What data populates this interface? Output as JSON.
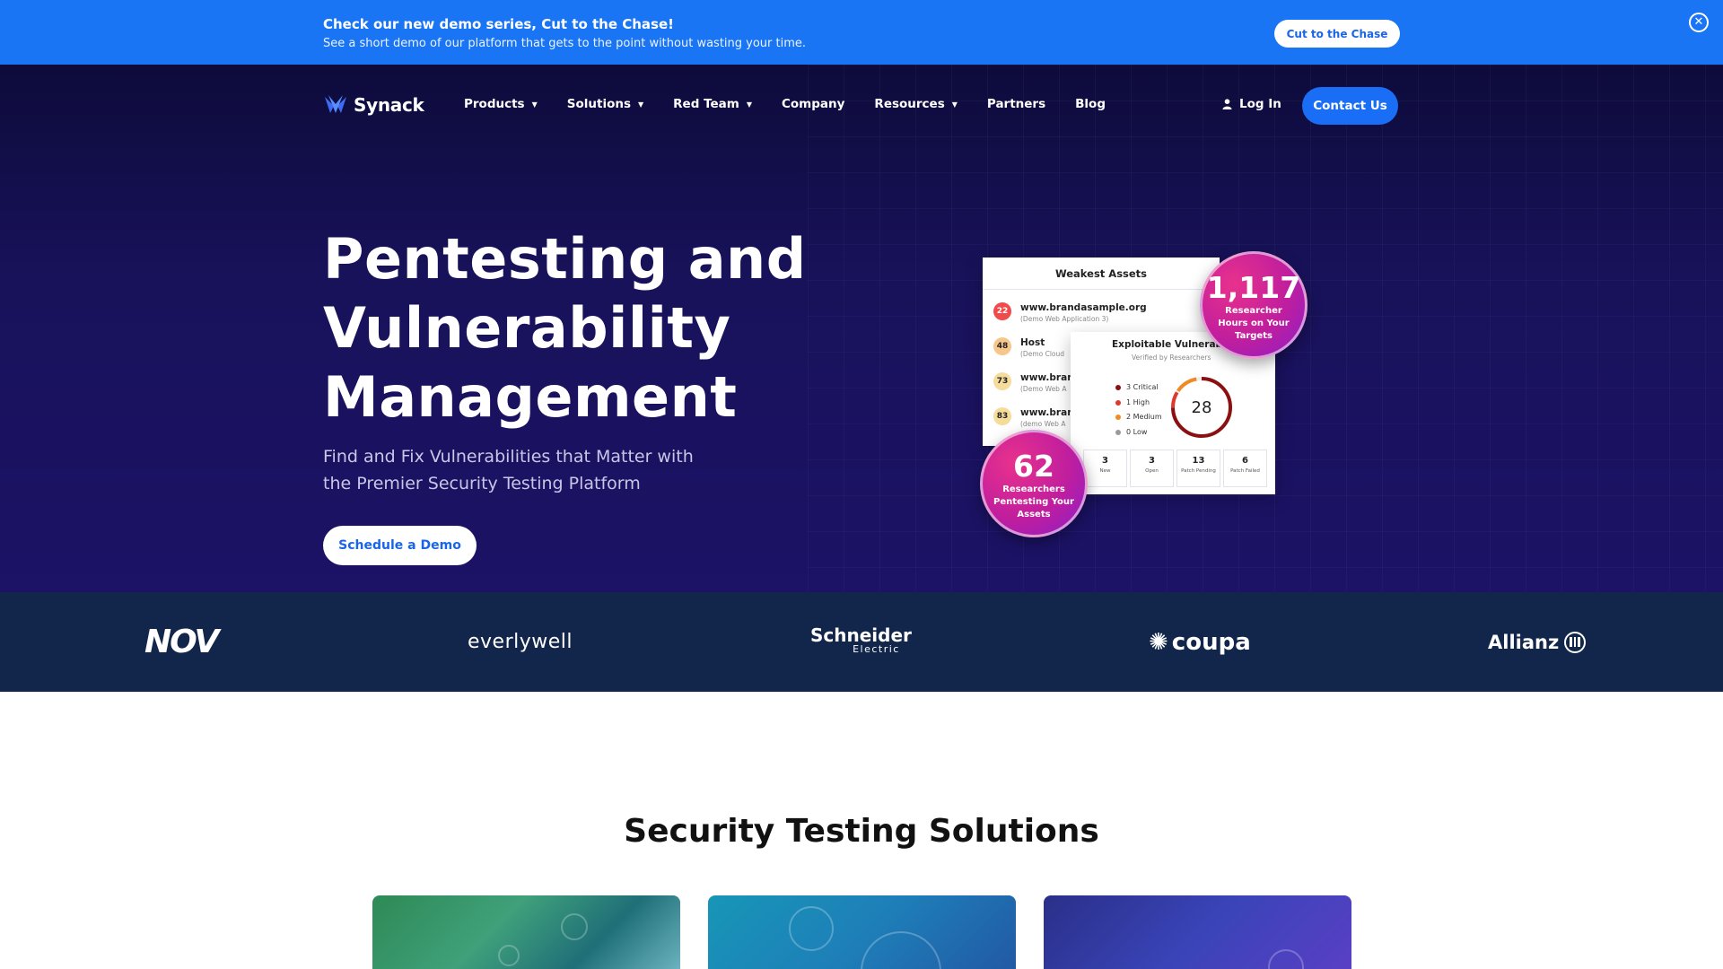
{
  "announcement": {
    "title": "Check our new demo series, Cut to the Chase!",
    "subtitle": "See a short demo of our platform that gets to the point without wasting your time.",
    "cta_label": "Cut to the Chase",
    "close_icon": "close-circle-icon"
  },
  "nav": {
    "logo_text": "Synack",
    "items": [
      {
        "label": "Products",
        "has_caret": true
      },
      {
        "label": "Solutions",
        "has_caret": true
      },
      {
        "label": "Red Team",
        "has_caret": true
      },
      {
        "label": "Company",
        "has_caret": false
      },
      {
        "label": "Resources",
        "has_caret": true
      },
      {
        "label": "Partners",
        "has_caret": false
      },
      {
        "label": "Blog",
        "has_caret": false
      }
    ],
    "login_label": "Log In",
    "contact_label": "Contact Us"
  },
  "hero": {
    "heading_lines": [
      "Pentesting and",
      "Vulnerability",
      "Management"
    ],
    "lead_lines": [
      "Find and Fix Vulnerabilities that Matter with",
      "the Premier Security Testing Platform"
    ],
    "cta_label": "Schedule a Demo"
  },
  "dashboard": {
    "weakest_title": "Weakest Assets",
    "assets": [
      {
        "score": "22",
        "name": "www.brandasample.org",
        "sub": "(Demo Web Application 3)",
        "color": "#f04a4a"
      },
      {
        "score": "48",
        "name": "Host",
        "sub": "(Demo Cloud",
        "color": "#f7c68a"
      },
      {
        "score": "73",
        "name": "www.bran",
        "sub": "(Demo Web A",
        "color": "#f5dc9a"
      },
      {
        "score": "83",
        "name": "www.bran",
        "sub": "(demo Web A",
        "color": "#f5dc9a"
      }
    ],
    "exploitable_title": "Exploitable Vulnerabilitie",
    "exploitable_sub": "Verified by Researchers",
    "legend": [
      {
        "label": "3 Critical",
        "color": "#8b1010"
      },
      {
        "label": "1 High",
        "color": "#e0382b"
      },
      {
        "label": "2 Medium",
        "color": "#f08a24"
      },
      {
        "label": "0 Low",
        "color": "#9a9a9a"
      }
    ],
    "total": "28",
    "stats": [
      {
        "value": "3",
        "label": "New"
      },
      {
        "value": "3",
        "label": "Open"
      },
      {
        "value": "13",
        "label": "Patch Pending"
      },
      {
        "value": "6",
        "label": "Patch Failed"
      }
    ],
    "bubble_hours": {
      "value": "1,117",
      "label": "Researcher Hours on Your Targets"
    },
    "bubble_researchers": {
      "value": "62",
      "label": "Researchers Pentesting Your Assets"
    }
  },
  "logos": [
    "NOV",
    "everlywell",
    "Schneider",
    "Electric",
    "coupa",
    "Allianz"
  ],
  "solutions": {
    "title": "Security Testing Solutions"
  }
}
